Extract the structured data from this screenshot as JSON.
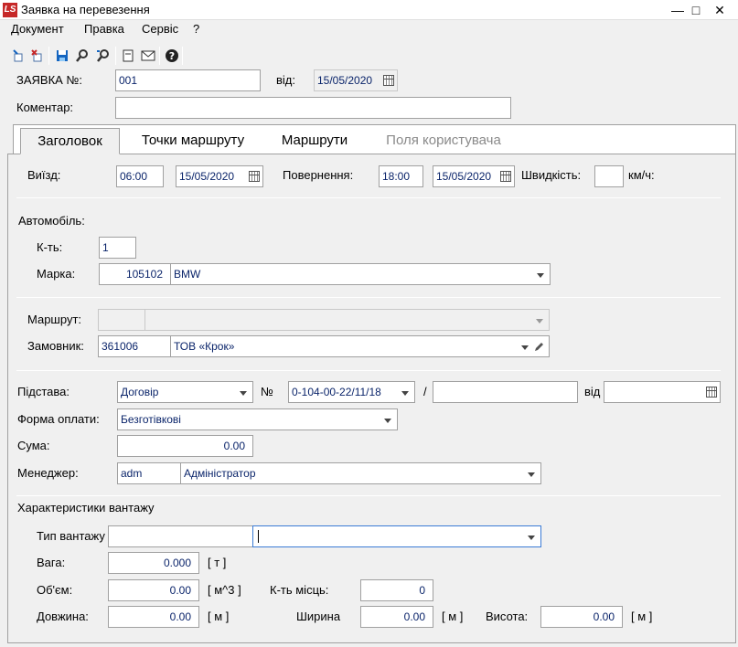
{
  "window": {
    "title": "Заявка на перевезення",
    "logo": "LS"
  },
  "menu": {
    "items": [
      "Документ",
      "Правка",
      "Сервіс",
      "?"
    ]
  },
  "toolbar": {
    "icons": [
      "new-doc-icon",
      "delete-doc-icon",
      "save-icon",
      "find-icon",
      "find-next-icon",
      "page-icon",
      "mail-icon",
      "help-icon"
    ]
  },
  "header": {
    "request_label": "ЗАЯВКА №:",
    "request_no": "001",
    "from_label": "від:",
    "from_date": "15/05/2020",
    "comment_label": "Коментар:",
    "comment": ""
  },
  "tabs": [
    "Заголовок",
    "Точки маршруту",
    "Маршрути",
    "Поля користувача"
  ],
  "trip": {
    "departure_label": "Виїзд:",
    "departure_time": "06:00",
    "departure_date": "15/05/2020",
    "return_label": "Повернення:",
    "return_time": "18:00",
    "return_date": "15/05/2020",
    "speed_label": "Швидкість:",
    "speed": "",
    "speed_unit": "км/ч:"
  },
  "car": {
    "section_label": "Автомобіль:",
    "count_label": "К-ть:",
    "count": "1",
    "brand_label": "Марка:",
    "brand_code": "105102",
    "brand_name": "BMW"
  },
  "route": {
    "route_label": "Маршрут:",
    "route_code": "",
    "route_name": "",
    "customer_label": "Замовник:",
    "customer_code": "361006",
    "customer_name": "ТОВ «Крок»"
  },
  "basis": {
    "basis_label": "Підстава:",
    "basis_value": "Договір",
    "number_label": "№",
    "number_value": "0-104-00-22/11/18",
    "slash": "/",
    "suffix": "",
    "date_label": "від",
    "date_value": "",
    "payment_label": "Форма оплати:",
    "payment_value": "Безготівкові",
    "sum_label": "Сума:",
    "sum_value": "0.00",
    "manager_label": "Менеджер:",
    "manager_code": "adm",
    "manager_name": "Адміністратор"
  },
  "cargo": {
    "section_label": "Характеристики вантажу",
    "type_label": "Тип вантажу",
    "type_code": "",
    "type_name": "",
    "weight_label": "Вага:",
    "weight": "0.000",
    "weight_unit": "[ т ]",
    "volume_label": "Об'єм:",
    "volume": "0.00",
    "volume_unit": "[ м^3 ]",
    "places_label": "К-ть місць:",
    "places": "0",
    "length_label": "Довжина:",
    "length": "0.00",
    "length_unit": "[ м ]",
    "width_label": "Ширина",
    "width": "0.00",
    "width_unit": "[ м ]",
    "height_label": "Висота:",
    "height": "0.00",
    "height_unit": "[ м ]"
  }
}
